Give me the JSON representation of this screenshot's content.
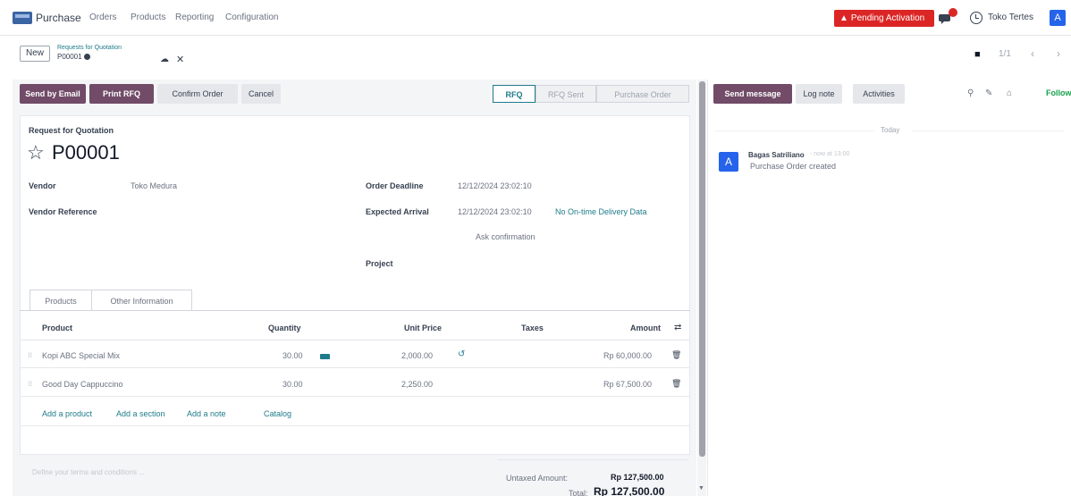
{
  "topnav": {
    "app_name": "Purchase",
    "menu": [
      "Orders",
      "Products",
      "Reporting",
      "Configuration"
    ],
    "pending_label": "Pending Activation",
    "company": "Toko Tertes",
    "avatar_letter": "A",
    "accent": "#714b67",
    "alert_color": "#dc2626"
  },
  "control": {
    "new_label": "New",
    "breadcrumb": "Requests for Quotation",
    "record_id": "P00001",
    "pager": "1/1",
    "prev_glyph": "‹",
    "next_glyph": "›"
  },
  "statusbar": {
    "buttons": {
      "send_email": "Send by Email",
      "print_rfq": "Print RFQ",
      "confirm": "Confirm Order",
      "cancel": "Cancel"
    },
    "stages": [
      "RFQ",
      "RFQ Sent",
      "Purchase Order"
    ],
    "active_stage": "RFQ"
  },
  "form": {
    "type_label": "Request for Quotation",
    "title": "P00001",
    "vendor_label": "Vendor",
    "vendor_value": "Toko Medura",
    "vendor_ref_label": "Vendor Reference",
    "order_deadline_label": "Order Deadline",
    "order_deadline_value": "12/12/2024 23:02:10",
    "expected_arrival_label": "Expected Arrival",
    "expected_arrival_value": "12/12/2024 23:02:10",
    "no_ontime": "No On-time Delivery Data",
    "ask_confirmation": "Ask confirmation",
    "project_label": "Project",
    "required_mark": "?"
  },
  "tabs": [
    "Products",
    "Other Information"
  ],
  "table": {
    "columns": [
      "Product",
      "Quantity",
      "Unit Price",
      "Taxes",
      "Amount"
    ],
    "rows": [
      {
        "product": "Kopi ABC Special Mix",
        "quantity": "30.00",
        "unit_price": "2,000.00",
        "taxes": "",
        "amount": "Rp 60,000.00"
      },
      {
        "product": "Good Day Cappuccino",
        "quantity": "30.00",
        "unit_price": "2,250.00",
        "taxes": "",
        "amount": "Rp 67,500.00"
      }
    ],
    "add_links": [
      "Add a product",
      "Add a section",
      "Add a note",
      "Catalog"
    ]
  },
  "footer": {
    "terms_placeholder": "Define your terms and conditions ...",
    "untaxed_label": "Untaxed Amount:",
    "untaxed_value": "Rp 127,500.00",
    "total_label": "Total:",
    "total_value": "Rp 127,500.00"
  },
  "chatter": {
    "send_message": "Send message",
    "log_note": "Log note",
    "activities": "Activities",
    "following": "Following",
    "today": "Today",
    "author": "Bagas Satriliano",
    "time": "- now at 13:00",
    "message": "Purchase Order created",
    "avatar_letter": "A"
  },
  "icons": {
    "star": "☆",
    "cloud": "☁",
    "close": "✕",
    "pin": "📌",
    "undo": "↺",
    "trash": "🗑",
    "sort": "⇄",
    "handle": "⁝⁝",
    "search": "⚲",
    "paperclip": "✎",
    "person": "⌂"
  }
}
